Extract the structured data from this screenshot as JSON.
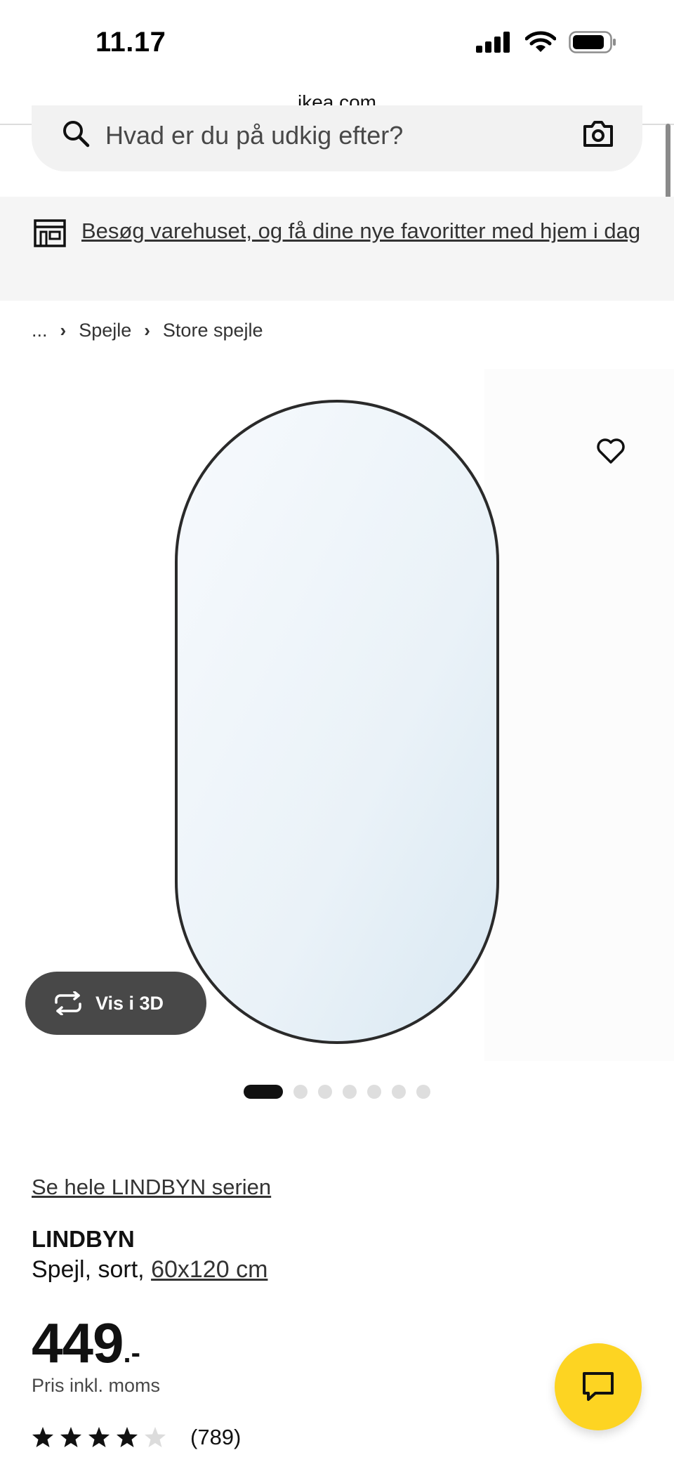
{
  "status_bar": {
    "time": "11.17"
  },
  "browser": {
    "url": "ikea.com"
  },
  "search": {
    "placeholder": "Hvad er du på udkig efter?"
  },
  "banner": {
    "text": "Besøg varehuset, og få dine nye favoritter med hjem i dag"
  },
  "breadcrumb": {
    "ellipsis": "...",
    "items": [
      "Spejle",
      "Store spejle"
    ]
  },
  "gallery": {
    "view_3d_label": "Vis i 3D",
    "slide_count": 7,
    "active_slide": 1
  },
  "product": {
    "series_link": "Se hele LINDBYN serien",
    "name": "LINDBYN",
    "description_prefix": "Spejl, sort, ",
    "size_link": "60x120 cm",
    "price": "449",
    "price_suffix": ".-",
    "price_note": "Pris inkl. moms",
    "rating_value": 4.5,
    "rating_count": "(789)"
  },
  "colors": {
    "chat_yellow": "#FDD422",
    "pill_dark": "#484848",
    "mirror_glass": "#E2EEF6"
  },
  "icons": [
    "search-icon",
    "camera-icon",
    "store-icon",
    "heart-icon",
    "rotate-3d-icon",
    "chat-icon",
    "star-icon",
    "signal-icon",
    "wifi-icon",
    "battery-icon"
  ]
}
